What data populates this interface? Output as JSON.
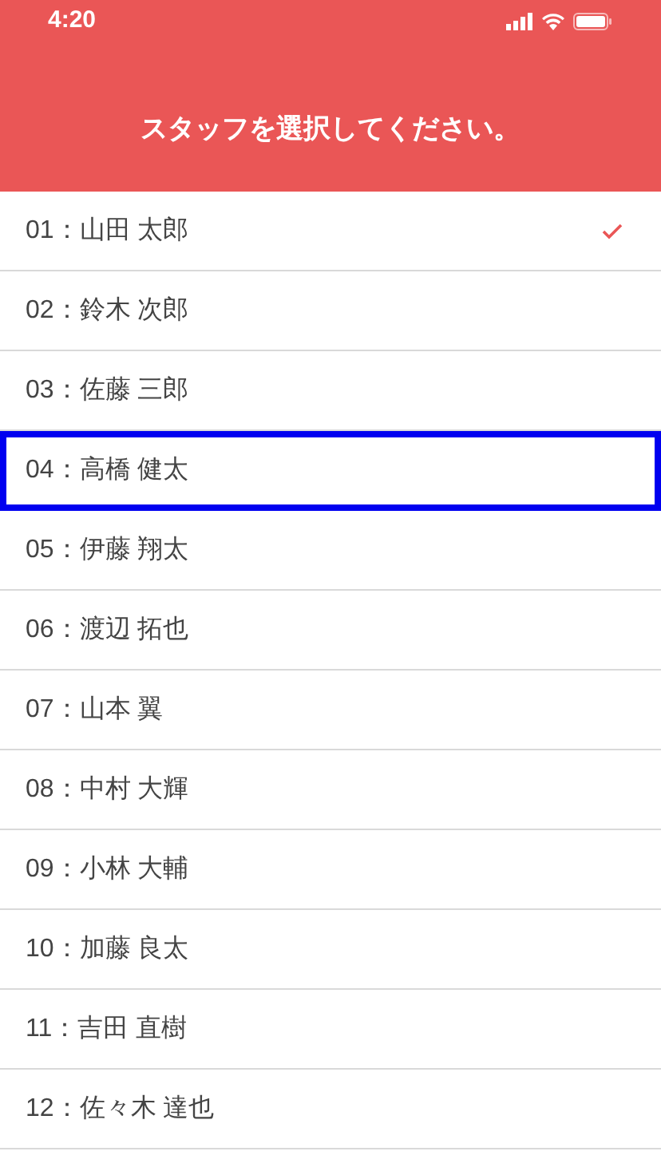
{
  "status_bar": {
    "time": "4:20"
  },
  "header": {
    "title": "スタッフを選択してください。"
  },
  "staff": [
    {
      "label": "01：山田 太郎",
      "checked": true,
      "focused": false
    },
    {
      "label": "02：鈴木 次郎",
      "checked": false,
      "focused": false
    },
    {
      "label": "03：佐藤 三郎",
      "checked": false,
      "focused": false
    },
    {
      "label": "04：高橋 健太",
      "checked": false,
      "focused": true
    },
    {
      "label": "05：伊藤 翔太",
      "checked": false,
      "focused": false
    },
    {
      "label": "06：渡辺 拓也",
      "checked": false,
      "focused": false
    },
    {
      "label": "07：山本 翼",
      "checked": false,
      "focused": false
    },
    {
      "label": "08：中村 大輝",
      "checked": false,
      "focused": false
    },
    {
      "label": "09：小林 大輔",
      "checked": false,
      "focused": false
    },
    {
      "label": "10：加藤 良太",
      "checked": false,
      "focused": false
    },
    {
      "label": "11：吉田 直樹",
      "checked": false,
      "focused": false
    },
    {
      "label": "12：佐々木 達也",
      "checked": false,
      "focused": false
    }
  ]
}
